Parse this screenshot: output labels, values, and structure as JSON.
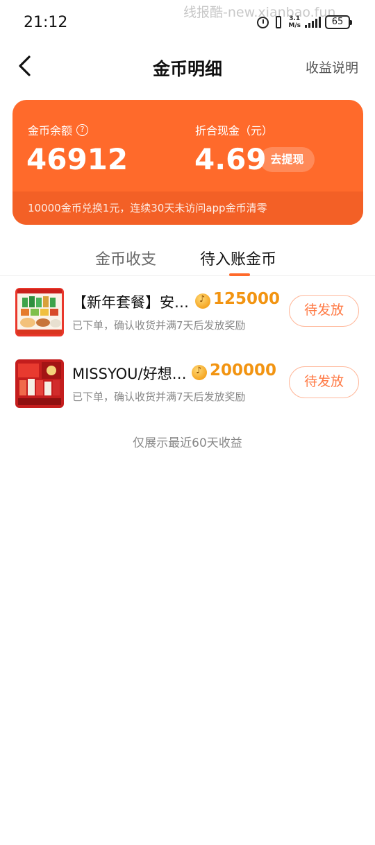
{
  "status_bar": {
    "time": "21:12",
    "watermark": "线报酷-new.xianbao.fun",
    "speed_value": "3.1",
    "speed_unit": "M/s",
    "battery": "65"
  },
  "nav": {
    "title": "金币明细",
    "right_link": "收益说明"
  },
  "balance_card": {
    "balance_label": "金币余额",
    "balance_value": "46912",
    "cash_label": "折合现金（元）",
    "cash_value": "4.69",
    "withdraw_label": "去提现",
    "footer_note": "10000金币兑换1元，连续30天未访问app金币清零",
    "color": "#ff6a2b"
  },
  "tabs": [
    {
      "label": "金币收支",
      "active": false
    },
    {
      "label": "待入账金币",
      "active": true
    }
  ],
  "pending_items": [
    {
      "title": "【新年套餐】安…",
      "amount": "125000",
      "desc": "已下单，确认收货并满7天后发放奖励",
      "status": "待发放",
      "thumb_icon": "snack-gift-box-thumbnail"
    },
    {
      "title": "MISSYOU/好想…",
      "amount": "200000",
      "desc": "已下单，确认收货并满7天后发放奖励",
      "status": "待发放",
      "thumb_icon": "red-gift-set-thumbnail"
    }
  ],
  "footer_note": "仅展示最近60天收益",
  "colors": {
    "accent": "#ff6a2b",
    "amount": "#f29411",
    "status_button": "#ff7a45"
  }
}
